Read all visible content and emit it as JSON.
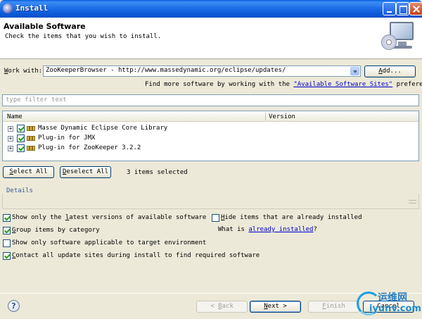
{
  "window": {
    "title": "Install"
  },
  "header": {
    "title": "Available Software",
    "subtitle": "Check the items that you wish to install."
  },
  "work_with": {
    "label_prefix": "",
    "label_mnemonic": "W",
    "label_rest": "ork with:",
    "value": "ZooKeeperBrowser - http://www.massedynamic.org/eclipse/updates/",
    "add_mnemonic": "A",
    "add_rest": "dd...",
    "more_prefix": "Find more software by working with the ",
    "more_link": "\"Available Software Sites\"",
    "more_suffix": " preferences."
  },
  "filter": {
    "placeholder": "type filter text"
  },
  "tree": {
    "col_name": "Name",
    "col_version": "Version",
    "items": [
      {
        "label": "Masse Dynamic Eclipse Core Library",
        "checked": true
      },
      {
        "label": "Plug-in for JMX",
        "checked": true
      },
      {
        "label": "Plug-in for ZooKeeper 3.2.2",
        "checked": true
      }
    ]
  },
  "selection": {
    "select_all_mnemonic": "S",
    "select_all_rest": "elect All",
    "deselect_all_mnemonic": "D",
    "deselect_all_rest": "eselect All",
    "status": "3 items selected"
  },
  "details": {
    "label": "Details"
  },
  "options": {
    "latest_pre": "Show only the ",
    "latest_mn": "l",
    "latest_post": "atest versions of available software",
    "latest_checked": true,
    "group_mn": "G",
    "group_post": "roup items by category",
    "group_checked": true,
    "target": "Show only software applicable to target environment",
    "target_checked": false,
    "contact_mn": "C",
    "contact_post": "ontact all update sites during install to find required software",
    "contact_checked": true,
    "hide_mn": "H",
    "hide_post": "ide items that are already installed",
    "hide_checked": false,
    "what_is": "What is ",
    "already_installed_link": "already installed",
    "what_is_suffix": "?"
  },
  "footer": {
    "back_pre": "< ",
    "back_mn": "B",
    "back_post": "ack",
    "next_mn": "N",
    "next_post": "ext >",
    "finish_mn": "F",
    "finish_post": "inish",
    "cancel": "Cancel"
  },
  "watermark": {
    "chinese": "运维网",
    "url": "iyunv.com"
  }
}
